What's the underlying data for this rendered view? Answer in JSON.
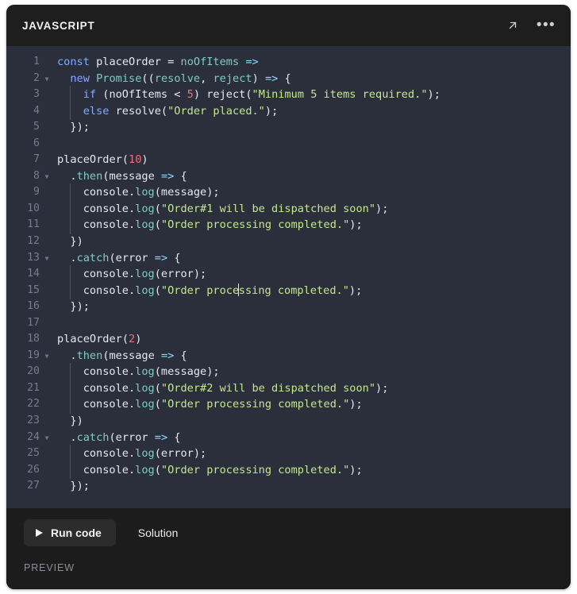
{
  "header": {
    "language_label": "JAVASCRIPT",
    "expand_icon": "expand-arrow-icon",
    "menu_icon": "more-options-icon"
  },
  "editor": {
    "language": "javascript",
    "cursor_line": 15,
    "cursor_column": 28,
    "colors": {
      "background": "#2b2f3b",
      "header_background": "#1e1e1e",
      "gutter_text": "#737d92",
      "default_text": "#e6e9ef",
      "keyword": "#82aaff",
      "function": "#80cbc4",
      "string": "#c3e88d",
      "number": "#f07178",
      "operator": "#89ddff",
      "indent_guide": "#4a5264"
    },
    "lines": [
      {
        "n": 1,
        "fold": false,
        "indent": 0,
        "text": "const placeOrder = noOfItems =>"
      },
      {
        "n": 2,
        "fold": true,
        "indent": 0,
        "text": "  new Promise((resolve, reject) => {"
      },
      {
        "n": 3,
        "fold": false,
        "indent": 1,
        "text": "    if (noOfItems < 5) reject(\"Minimum 5 items required.\");"
      },
      {
        "n": 4,
        "fold": false,
        "indent": 1,
        "text": "    else resolve(\"Order placed.\");"
      },
      {
        "n": 5,
        "fold": false,
        "indent": 0,
        "text": "  });"
      },
      {
        "n": 6,
        "fold": false,
        "indent": 0,
        "text": ""
      },
      {
        "n": 7,
        "fold": false,
        "indent": 0,
        "text": "placeOrder(10)"
      },
      {
        "n": 8,
        "fold": true,
        "indent": 0,
        "text": "  .then(message => {"
      },
      {
        "n": 9,
        "fold": false,
        "indent": 1,
        "text": "    console.log(message);"
      },
      {
        "n": 10,
        "fold": false,
        "indent": 1,
        "text": "    console.log(\"Order#1 will be dispatched soon\");"
      },
      {
        "n": 11,
        "fold": false,
        "indent": 1,
        "text": "    console.log(\"Order processing completed.\");"
      },
      {
        "n": 12,
        "fold": false,
        "indent": 0,
        "text": "  })"
      },
      {
        "n": 13,
        "fold": true,
        "indent": 0,
        "text": "  .catch(error => {"
      },
      {
        "n": 14,
        "fold": false,
        "indent": 1,
        "text": "    console.log(error);"
      },
      {
        "n": 15,
        "fold": false,
        "indent": 1,
        "text": "    console.log(\"Order processing completed.\");"
      },
      {
        "n": 16,
        "fold": false,
        "indent": 0,
        "text": "  });"
      },
      {
        "n": 17,
        "fold": false,
        "indent": 0,
        "text": ""
      },
      {
        "n": 18,
        "fold": false,
        "indent": 0,
        "text": "placeOrder(2)"
      },
      {
        "n": 19,
        "fold": true,
        "indent": 0,
        "text": "  .then(message => {"
      },
      {
        "n": 20,
        "fold": false,
        "indent": 1,
        "text": "    console.log(message);"
      },
      {
        "n": 21,
        "fold": false,
        "indent": 1,
        "text": "    console.log(\"Order#2 will be dispatched soon\");"
      },
      {
        "n": 22,
        "fold": false,
        "indent": 1,
        "text": "    console.log(\"Order processing completed.\");"
      },
      {
        "n": 23,
        "fold": false,
        "indent": 0,
        "text": "  })"
      },
      {
        "n": 24,
        "fold": true,
        "indent": 0,
        "text": "  .catch(error => {"
      },
      {
        "n": 25,
        "fold": false,
        "indent": 1,
        "text": "    console.log(error);"
      },
      {
        "n": 26,
        "fold": false,
        "indent": 1,
        "text": "    console.log(\"Order processing completed.\");"
      },
      {
        "n": 27,
        "fold": false,
        "indent": 0,
        "text": "  });"
      }
    ]
  },
  "toolbar": {
    "run_label": "Run code",
    "run_icon": "play-icon",
    "solution_label": "Solution"
  },
  "preview": {
    "label": "PREVIEW"
  }
}
